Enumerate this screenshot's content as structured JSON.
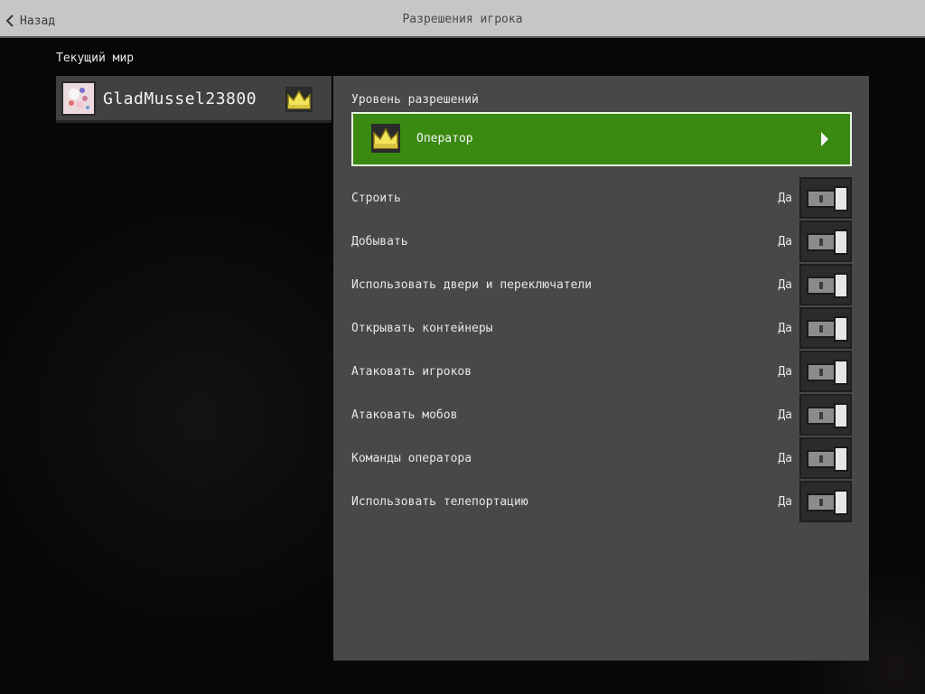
{
  "header": {
    "back_label": "Назад",
    "title": "Разрешения игрока"
  },
  "sidebar": {
    "section_label": "Текущий мир",
    "player": {
      "name": "GladMussel23800",
      "avatar_icon": "player-avatar",
      "rank_icon": "crown-icon"
    }
  },
  "panel": {
    "level_label": "Уровень разрешений",
    "level_value": "Оператор",
    "level_icon": "crown-icon",
    "permissions": [
      {
        "label": "Строить",
        "value": "Да",
        "enabled": true
      },
      {
        "label": "Добывать",
        "value": "Да",
        "enabled": true
      },
      {
        "label": "Использовать двери и переключатели",
        "value": "Да",
        "enabled": true
      },
      {
        "label": "Открывать контейнеры",
        "value": "Да",
        "enabled": true
      },
      {
        "label": "Атаковать игроков",
        "value": "Да",
        "enabled": true
      },
      {
        "label": "Атаковать мобов",
        "value": "Да",
        "enabled": true
      },
      {
        "label": "Команды оператора",
        "value": "Да",
        "enabled": true
      },
      {
        "label": "Использовать телепортацию",
        "value": "Да",
        "enabled": true
      }
    ]
  },
  "colors": {
    "accent_green": "#3a8a11",
    "panel": "#484848",
    "crown": "#f3e35a"
  }
}
